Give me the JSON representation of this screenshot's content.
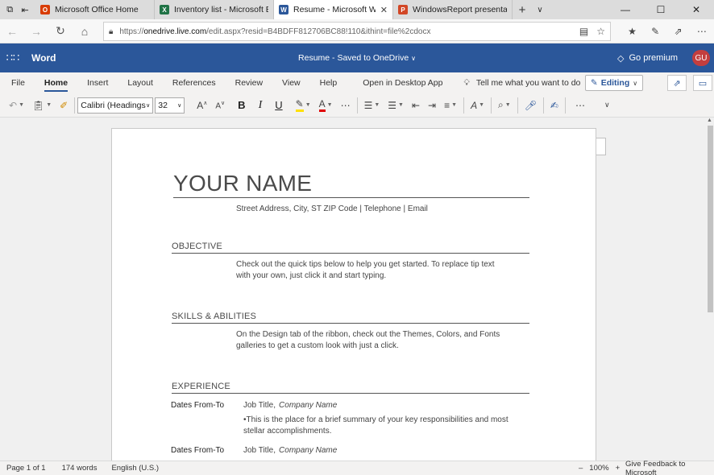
{
  "browser": {
    "tabs": [
      {
        "title": "Microsoft Office Home",
        "icon": "office-icon",
        "color": "#d83b01",
        "active": false
      },
      {
        "title": "Inventory list - Microsoft Ex",
        "icon": "excel-icon",
        "color": "#217346",
        "active": false
      },
      {
        "title": "Resume - Microsoft Wo",
        "icon": "word-icon",
        "color": "#2b579a",
        "active": true
      },
      {
        "title": "WindowsReport presentatic",
        "icon": "powerpoint-icon",
        "color": "#d24726",
        "active": false
      }
    ],
    "url_prefix": "https://",
    "url_host": "onedrive.live.com",
    "url_path": "/edit.aspx?resid=B4BDFF812706BC88!110&ithint=file%2cdocx"
  },
  "word": {
    "app_name": "Word",
    "doc_title": "Resume  -  Saved to OneDrive",
    "go_premium": "Go premium",
    "avatar_initials": "GU",
    "brand_color": "#2b579a"
  },
  "ribbon": {
    "tabs": [
      "File",
      "Home",
      "Insert",
      "Layout",
      "References",
      "Review",
      "View",
      "Help"
    ],
    "active_tab": "Home",
    "open_desktop": "Open in Desktop App",
    "tell_me": "Tell me what you want to do",
    "editing": "Editing",
    "font_name": "Calibri (Headings",
    "font_size": "32"
  },
  "document": {
    "name": "YOUR NAME",
    "contact": "Street Address, City, ST ZIP Code | Telephone | Email",
    "objective_heading": "OBJECTIVE",
    "objective_line1": "Check out the quick tips below to help you get started. To replace tip text",
    "objective_line2": "with your own, just click it and start typing.",
    "skills_heading": "SKILLS & ABILITIES",
    "skills_line1": "On the Design tab of the ribbon, check out the Themes, Colors, and Fonts",
    "skills_line2": "galleries to get a custom look with just a click.",
    "experience_heading": "EXPERIENCE",
    "entries": [
      {
        "dates": "Dates From-To",
        "job_title": "Job Title,",
        "company": "Company Name",
        "bullet_line1": "This is the place for a brief summary of your key responsibilities and most",
        "bullet_line2": "stellar accomplishments."
      },
      {
        "dates": "Dates From-To",
        "job_title": "Job Title,",
        "company": "Company Name"
      }
    ]
  },
  "status": {
    "page": "Page 1 of 1",
    "words": "174 words",
    "language": "English (U.S.)",
    "zoom": "100%",
    "feedback": "Give Feedback to Microsoft"
  }
}
